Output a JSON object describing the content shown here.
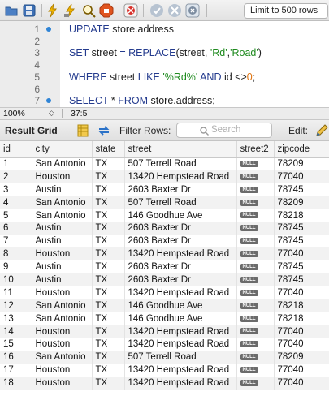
{
  "toolbar": {
    "icons": [
      "open-folder-icon",
      "save-icon",
      "execute-lightning-icon",
      "execute-current-lightning-icon",
      "explain-magnifier-icon",
      "stop-icon",
      "toggle-error-icon",
      "commit-icon",
      "rollback-icon",
      "auto-commit-icon"
    ],
    "limit_label": "Limit to 500 rows"
  },
  "editor": {
    "lines": [
      {
        "num": "1",
        "dot": true,
        "tokens": [
          [
            "kw",
            "UPDATE "
          ],
          [
            "ident",
            "store.address"
          ]
        ]
      },
      {
        "num": "2",
        "dot": false,
        "tokens": []
      },
      {
        "num": "3",
        "dot": false,
        "tokens": [
          [
            "kw",
            "SET "
          ],
          [
            "ident",
            "street "
          ],
          [
            "kw",
            "= REPLACE"
          ],
          [
            "ident",
            "(street, "
          ],
          [
            "str",
            "'Rd'"
          ],
          [
            "ident",
            ","
          ],
          [
            "str",
            "'Road'"
          ],
          [
            "ident",
            ")"
          ]
        ]
      },
      {
        "num": "4",
        "dot": false,
        "tokens": []
      },
      {
        "num": "5",
        "dot": false,
        "tokens": [
          [
            "kw",
            "WHERE "
          ],
          [
            "ident",
            "street "
          ],
          [
            "kw",
            "LIKE "
          ],
          [
            "str",
            "'%Rd%' "
          ],
          [
            "kw",
            "AND "
          ],
          [
            "ident",
            "id <>"
          ],
          [
            "num",
            "0"
          ],
          [
            "ident",
            ";"
          ]
        ]
      },
      {
        "num": "6",
        "dot": false,
        "tokens": []
      },
      {
        "num": "7",
        "dot": true,
        "tokens": [
          [
            "kw",
            "SELECT "
          ],
          [
            "ident",
            "* "
          ],
          [
            "kw",
            "FROM "
          ],
          [
            "ident",
            "store.address;"
          ]
        ]
      }
    ]
  },
  "status": {
    "zoom": "100%",
    "stepper": "◇",
    "cursor": "37:5"
  },
  "result_toolbar": {
    "result_grid_label": "Result Grid",
    "filter_label": "Filter Rows:",
    "search_placeholder": "Search",
    "edit_label": "Edit:"
  },
  "grid": {
    "columns": [
      "id",
      "city",
      "state",
      "street",
      "street2",
      "zipcode"
    ],
    "null_label": "NULL",
    "rows": [
      [
        "1",
        "San Antonio",
        "TX",
        "507 Terrell Road",
        "NULL",
        "78209"
      ],
      [
        "2",
        "Houston",
        "TX",
        "13420 Hempstead Road",
        "NULL",
        "77040"
      ],
      [
        "3",
        "Austin",
        "TX",
        "2603 Baxter Dr",
        "NULL",
        "78745"
      ],
      [
        "4",
        "San Antonio",
        "TX",
        "507 Terrell Road",
        "NULL",
        "78209"
      ],
      [
        "5",
        "San Antonio",
        "TX",
        "146 Goodhue Ave",
        "NULL",
        "78218"
      ],
      [
        "6",
        "Austin",
        "TX",
        "2603 Baxter Dr",
        "NULL",
        "78745"
      ],
      [
        "7",
        "Austin",
        "TX",
        "2603 Baxter Dr",
        "NULL",
        "78745"
      ],
      [
        "8",
        "Houston",
        "TX",
        "13420 Hempstead Road",
        "NULL",
        "77040"
      ],
      [
        "9",
        "Austin",
        "TX",
        "2603 Baxter Dr",
        "NULL",
        "78745"
      ],
      [
        "10",
        "Austin",
        "TX",
        "2603 Baxter Dr",
        "NULL",
        "78745"
      ],
      [
        "11",
        "Houston",
        "TX",
        "13420 Hempstead Road",
        "NULL",
        "77040"
      ],
      [
        "12",
        "San Antonio",
        "TX",
        "146 Goodhue Ave",
        "NULL",
        "78218"
      ],
      [
        "13",
        "San Antonio",
        "TX",
        "146 Goodhue Ave",
        "NULL",
        "78218"
      ],
      [
        "14",
        "Houston",
        "TX",
        "13420 Hempstead Road",
        "NULL",
        "77040"
      ],
      [
        "15",
        "Houston",
        "TX",
        "13420 Hempstead Road",
        "NULL",
        "77040"
      ],
      [
        "16",
        "San Antonio",
        "TX",
        "507 Terrell Road",
        "NULL",
        "78209"
      ],
      [
        "17",
        "Houston",
        "TX",
        "13420 Hempstead Road",
        "NULL",
        "77040"
      ],
      [
        "18",
        "Houston",
        "TX",
        "13420 Hempstead Road",
        "NULL",
        "77040"
      ]
    ]
  },
  "colors": {
    "keyword": "#243b8e",
    "string": "#1e8a1e",
    "number": "#e0730e",
    "accent": "#2f84d6"
  }
}
